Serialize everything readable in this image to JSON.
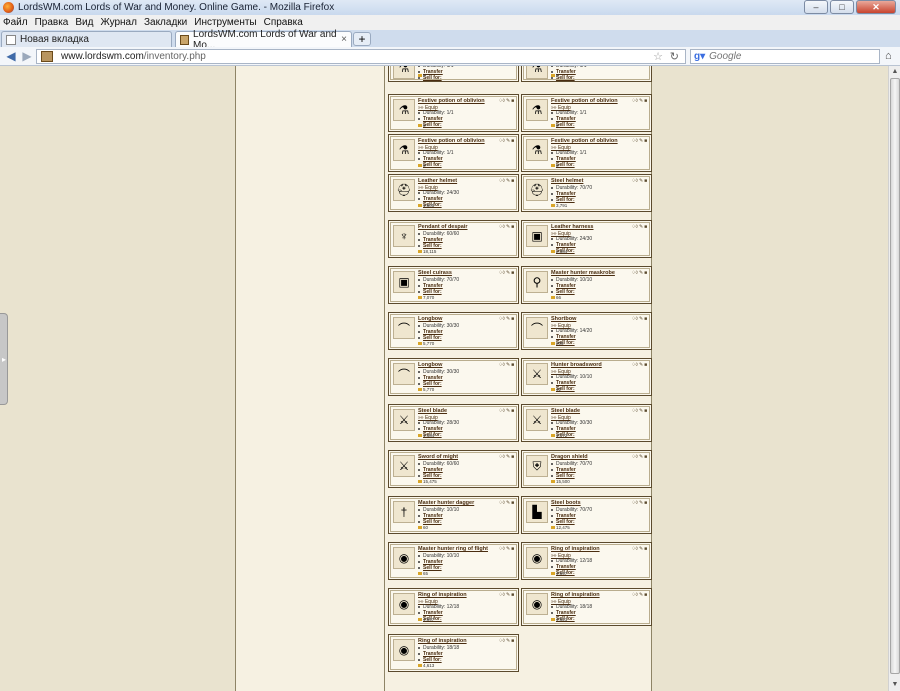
{
  "window": {
    "title": "LordsWM.com Lords of War and Money. Online Game. - Mozilla Firefox"
  },
  "menu": [
    "Файл",
    "Правка",
    "Вид",
    "Журнал",
    "Закладки",
    "Инструменты",
    "Справка"
  ],
  "tabs": [
    {
      "label": "Новая вкладка",
      "close": "×"
    },
    {
      "label": "LordsWM.com Lords of War and Mo...",
      "close": "×"
    }
  ],
  "new_tab_label": "+",
  "address": {
    "host": "www.lordswm.com",
    "path": "/inventory.php"
  },
  "search": {
    "placeholder": "Google"
  },
  "labels": {
    "durability_prefix": "Durability: ",
    "transfer": "Transfer",
    "sell": "Sell for:",
    "equip": "»» Equip",
    "actions": "♢◊ ✎ ■"
  },
  "items": [
    {
      "name": "",
      "durability": "1/1",
      "equip": false,
      "price": "8",
      "icon": "potion-icon"
    },
    {
      "name": "",
      "durability": "1/1",
      "equip": false,
      "price": "8",
      "icon": "potion-icon"
    },
    {
      "name": "Festive potion of oblivion",
      "durability": "1/1",
      "equip": true,
      "price": "8",
      "icon": "potion-icon"
    },
    {
      "name": "Festive potion of oblivion",
      "durability": "1/1",
      "equip": true,
      "price": "8",
      "icon": "potion-icon"
    },
    {
      "name": "Festive potion of oblivion",
      "durability": "1/1",
      "equip": true,
      "price": "8",
      "icon": "potion-icon"
    },
    {
      "name": "Festive potion of oblivion",
      "durability": "1/1",
      "equip": true,
      "price": "8",
      "icon": "potion-icon"
    },
    {
      "name": "Leather helmet",
      "durability": "24/30",
      "equip": true,
      "price": "1,505",
      "icon": "helmet-icon"
    },
    {
      "name": "Steel helmet",
      "durability": "70/70",
      "equip": false,
      "price": "3,791",
      "icon": "helmet-icon"
    },
    {
      "name": "Pendant of despair",
      "durability": "60/60",
      "equip": false,
      "price": "18,115",
      "icon": "pendant-icon"
    },
    {
      "name": "Leather harness",
      "durability": "24/30",
      "equip": true,
      "price": "2,384",
      "icon": "armor-icon"
    },
    {
      "name": "Steel cuirass",
      "durability": "70/70",
      "equip": false,
      "price": "7,070",
      "icon": "armor-icon"
    },
    {
      "name": "Master hunter maskrobe",
      "durability": "10/10",
      "equip": false,
      "price": "66",
      "icon": "robe-icon"
    },
    {
      "name": "Longbow",
      "durability": "30/30",
      "equip": false,
      "price": "5,770",
      "icon": "bow-icon"
    },
    {
      "name": "Shortbow",
      "durability": "14/20",
      "equip": true,
      "price": "205",
      "icon": "bow-icon"
    },
    {
      "name": "Longbow",
      "durability": "30/30",
      "equip": false,
      "price": "5,770",
      "icon": "bow-icon"
    },
    {
      "name": "Hunter broadsword",
      "durability": "10/10",
      "equip": true,
      "price": "42",
      "icon": "sword-icon"
    },
    {
      "name": "Steel blade",
      "durability": "28/30",
      "equip": true,
      "price": "1,184",
      "icon": "sword-icon"
    },
    {
      "name": "Steel blade",
      "durability": "30/30",
      "equip": true,
      "price": "1,172",
      "icon": "sword-icon"
    },
    {
      "name": "Sword of might",
      "durability": "60/60",
      "equip": false,
      "price": "15,475",
      "icon": "sword-icon"
    },
    {
      "name": "Dragon shield",
      "durability": "70/70",
      "equip": false,
      "price": "15,500",
      "icon": "shield-icon"
    },
    {
      "name": "Master hunter dagger",
      "durability": "10/10",
      "equip": false,
      "price": "60",
      "icon": "dagger-icon"
    },
    {
      "name": "Steel boots",
      "durability": "70/70",
      "equip": false,
      "price": "12,475",
      "icon": "boots-icon"
    },
    {
      "name": "Master hunter ring of flight",
      "durability": "10/10",
      "equip": false,
      "price": "65",
      "icon": "ring-icon"
    },
    {
      "name": "Ring of inspiration",
      "durability": "12/18",
      "equip": true,
      "price": "4,597",
      "icon": "ring-icon"
    },
    {
      "name": "Ring of inspiration",
      "durability": "12/18",
      "equip": true,
      "price": "4,597",
      "icon": "ring-icon"
    },
    {
      "name": "Ring of inspiration",
      "durability": "18/18",
      "equip": true,
      "price": "4,621",
      "icon": "ring-icon"
    },
    {
      "name": "Ring of inspiration",
      "durability": "18/18",
      "equip": false,
      "price": "4,613",
      "icon": "ring-icon"
    }
  ]
}
